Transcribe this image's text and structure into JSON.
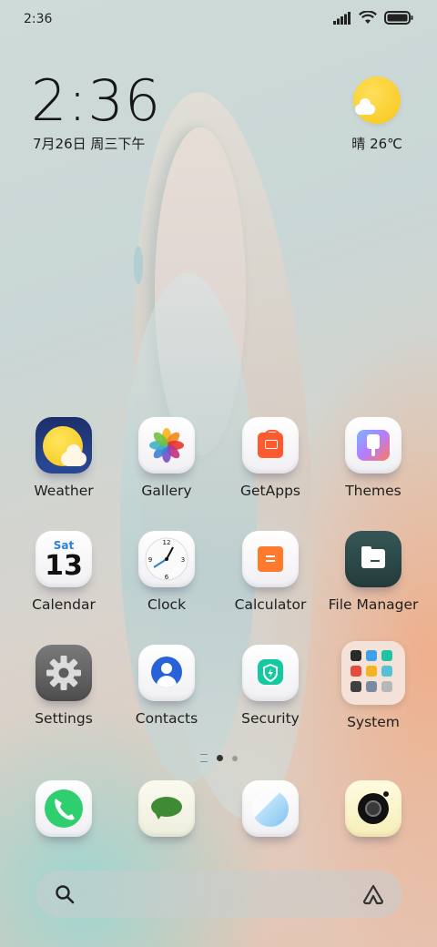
{
  "status_bar": {
    "time": "2:36"
  },
  "clock_widget": {
    "time": "2:36",
    "date": "7月26日 周三下午"
  },
  "weather_widget": {
    "condition_temp": "晴 26℃"
  },
  "apps": {
    "weather": "Weather",
    "gallery": "Gallery",
    "getapps": "GetApps",
    "themes": "Themes",
    "calendar": "Calendar",
    "calendar_day": "Sat",
    "calendar_date": "13",
    "clock": "Clock",
    "calculator": "Calculator",
    "file_manager": "File Manager",
    "settings": "Settings",
    "contacts": "Contacts",
    "security": "Security",
    "system": "System"
  },
  "dock": [
    "phone",
    "messages",
    "browser",
    "camera"
  ],
  "page_indicator": {
    "pages": 2,
    "current": 1
  },
  "colors": {
    "accent_sun": "#f7c51a",
    "getapps": "#ff5a2e",
    "calculator": "#ff7a2c",
    "security": "#14c8a0",
    "file_manager": "#2f4b4b"
  }
}
